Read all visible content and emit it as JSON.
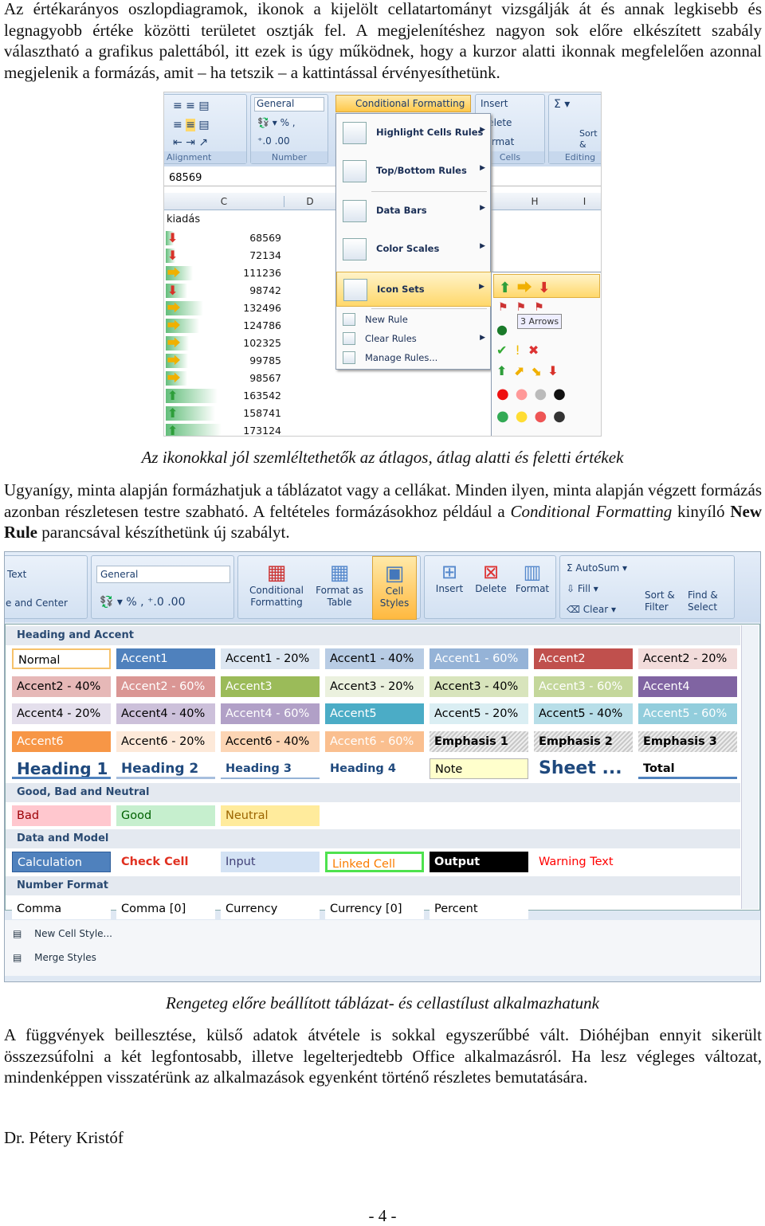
{
  "para1": "Az értékarányos oszlopdiagramok, ikonok a kijelölt cellatartományt vizsgálják át és annak legkisebb és legnagyobb értéke közötti területet osztják fel. A megjelenítéshez nagyon sok előre elkészített szabály választható a grafikus palettából, itt ezek is úgy működnek, hogy a kurzor alatti ikonnak megfelelően azonnal megjelenik a formázás, amit – ha tetszik – a kattintással érvényesíthetünk.",
  "shot1": {
    "ribbon": {
      "number_format": "General",
      "conditional_formatting": "Conditional Formatting",
      "insert": "Insert",
      "delete": "Delete",
      "format": "Format",
      "sort_filter": "Sort & Filter",
      "group_alignment": "Alignment",
      "group_number": "Number",
      "group_cells": "Cells",
      "group_editing": "Editing"
    },
    "formula_value": "68569",
    "columns": [
      "C",
      "D",
      "H",
      "I"
    ],
    "header_cell": "kiadás",
    "rows": [
      {
        "value": 68569,
        "icon": "arrow-down"
      },
      {
        "value": 72134,
        "icon": "arrow-down"
      },
      {
        "value": 111236,
        "icon": "arrow-right"
      },
      {
        "value": 98742,
        "icon": "arrow-down"
      },
      {
        "value": 132496,
        "icon": "arrow-right"
      },
      {
        "value": 124786,
        "icon": "arrow-right"
      },
      {
        "value": 102325,
        "icon": "arrow-right"
      },
      {
        "value": 99785,
        "icon": "arrow-right"
      },
      {
        "value": 98567,
        "icon": "arrow-right"
      },
      {
        "value": 163542,
        "icon": "arrow-up"
      },
      {
        "value": 158741,
        "icon": "arrow-up"
      },
      {
        "value": 173124,
        "icon": "arrow-up"
      }
    ],
    "menu": [
      "Highlight Cells Rules",
      "Top/Bottom Rules",
      "Data Bars",
      "Color Scales",
      "Icon Sets",
      "New Rule",
      "Clear Rules",
      "Manage Rules..."
    ],
    "tooltip": "3 Arrows",
    "colors": {
      "up": "#2e9e3a",
      "right": "#f0b000",
      "down": "#d8322a",
      "databar": "#63be7b",
      "highlight": "#ffd86b"
    }
  },
  "caption1": "Az ikonokkal jól szemléltethetők az átlagos, átlag alatti és feletti értékek",
  "para2": {
    "a": "Ugyanígy, minta alapján formázhatjuk a táblázatot vagy a cellákat. Minden ilyen, minta alapján végzett formázás azonban részletesen testre szabható. A feltételes formázásokhoz például a ",
    "b": "Conditional Formatting",
    "c": " kinyíló ",
    "d": "New Rule",
    "e": " parancsával készíthetünk új szabályt."
  },
  "shot2": {
    "ribbon": {
      "text": "Text",
      "merge": "e and Center",
      "number_format": "General",
      "conditional": "Conditional Formatting",
      "format_table": "Format as Table",
      "cell_styles": "Cell Styles",
      "insert": "Insert",
      "delete": "Delete",
      "format": "Format",
      "autosum": "AutoSum",
      "fill": "Fill",
      "clear": "Clear",
      "sort": "Sort & Filter",
      "find": "Find & Select"
    },
    "sections": [
      {
        "title": "Heading and Accent",
        "rows": [
          [
            {
              "n": "Normal",
              "bg": "#ffffff",
              "fg": "#000000",
              "b": "2px solid #f6c26b"
            },
            {
              "n": "Accent1",
              "bg": "#4f81bd",
              "fg": "#ffffff"
            },
            {
              "n": "Accent1 - 20%",
              "bg": "#dce6f1",
              "fg": "#000"
            },
            {
              "n": "Accent1 - 40%",
              "bg": "#b8cce4",
              "fg": "#000"
            },
            {
              "n": "Accent1 - 60%",
              "bg": "#95b3d7",
              "fg": "#fff"
            },
            {
              "n": "Accent2",
              "bg": "#c0504d",
              "fg": "#fff"
            },
            {
              "n": "Accent2 - 20%",
              "bg": "#f2dcdb",
              "fg": "#000"
            }
          ],
          [
            {
              "n": "Accent2 - 40%",
              "bg": "#e6b8b7",
              "fg": "#000"
            },
            {
              "n": "Accent2 - 60%",
              "bg": "#da9694",
              "fg": "#fff"
            },
            {
              "n": "Accent3",
              "bg": "#9bbb59",
              "fg": "#fff"
            },
            {
              "n": "Accent3 - 20%",
              "bg": "#ebf1de",
              "fg": "#000"
            },
            {
              "n": "Accent3 - 40%",
              "bg": "#d8e4bc",
              "fg": "#000"
            },
            {
              "n": "Accent3 - 60%",
              "bg": "#c4d79b",
              "fg": "#fff"
            },
            {
              "n": "Accent4",
              "bg": "#8064a2",
              "fg": "#fff"
            }
          ],
          [
            {
              "n": "Accent4 - 20%",
              "bg": "#e4dfec",
              "fg": "#000"
            },
            {
              "n": "Accent4 - 40%",
              "bg": "#ccc0da",
              "fg": "#000"
            },
            {
              "n": "Accent4 - 60%",
              "bg": "#b1a0c7",
              "fg": "#fff"
            },
            {
              "n": "Accent5",
              "bg": "#4bacc6",
              "fg": "#fff"
            },
            {
              "n": "Accent5 - 20%",
              "bg": "#daeef3",
              "fg": "#000"
            },
            {
              "n": "Accent5 - 40%",
              "bg": "#b7dee8",
              "fg": "#000"
            },
            {
              "n": "Accent5 - 60%",
              "bg": "#92cddc",
              "fg": "#fff"
            }
          ],
          [
            {
              "n": "Accent6",
              "bg": "#f79646",
              "fg": "#fff"
            },
            {
              "n": "Accent6 - 20%",
              "bg": "#fde9d9",
              "fg": "#000"
            },
            {
              "n": "Accent6 - 40%",
              "bg": "#fcd5b4",
              "fg": "#000"
            },
            {
              "n": "Accent6 - 60%",
              "bg": "#fabf8f",
              "fg": "#fff"
            },
            {
              "n": "Emphasis 1",
              "bg": "hatch",
              "fg": "#000",
              "w": "bold"
            },
            {
              "n": "Emphasis 2",
              "bg": "hatch",
              "fg": "#000",
              "w": "bold"
            },
            {
              "n": "Emphasis 3",
              "bg": "hatch",
              "fg": "#000",
              "w": "bold"
            }
          ],
          [
            {
              "n": "Heading 1",
              "bg": "#fff",
              "fg": "#1f497d",
              "w": "bold",
              "s": "20px",
              "b": "0 0 3px #4f81bd"
            },
            {
              "n": "Heading 2",
              "bg": "#fff",
              "fg": "#1f497d",
              "w": "bold",
              "s": "17px",
              "b": "0 0 3px #a7bfde"
            },
            {
              "n": "Heading 3",
              "bg": "#fff",
              "fg": "#1f497d",
              "w": "bold",
              "s": "14.5px",
              "b": "0 0 2px #95b3d7"
            },
            {
              "n": "Heading 4",
              "bg": "#fff",
              "fg": "#1f497d",
              "w": "bold",
              "s": "14.5px"
            },
            {
              "n": "Note",
              "bg": "#ffffcc",
              "fg": "#000",
              "b": "1px solid #b2b2b2"
            },
            {
              "n": "Sheet ...",
              "bg": "#fff",
              "fg": "#1f497d",
              "w": "bold",
              "s": "22px"
            },
            {
              "n": "Total",
              "bg": "#fff",
              "fg": "#000",
              "w": "bold",
              "b": "0 0 3px #4f81bd"
            }
          ]
        ]
      },
      {
        "title": "Good, Bad and Neutral",
        "rows": [
          [
            {
              "n": "Bad",
              "bg": "#ffc7ce",
              "fg": "#9c0006"
            },
            {
              "n": "Good",
              "bg": "#c6efce",
              "fg": "#006100"
            },
            {
              "n": "Neutral",
              "bg": "#ffeb9c",
              "fg": "#9c6500"
            }
          ]
        ]
      },
      {
        "title": "Data and Model",
        "rows": [
          [
            {
              "n": "Calculation",
              "bg": "#4f81bd",
              "fg": "#fff",
              "b": "1px solid #2d5d9a"
            },
            {
              "n": "Check Cell",
              "bg": "#fff",
              "fg": "#e03020",
              "w": "bold"
            },
            {
              "n": "Input",
              "bg": "#d3e2f4",
              "fg": "#3f3f76"
            },
            {
              "n": "Linked Cell",
              "bg": "#fff",
              "fg": "#fa7d00",
              "b": "3px solid #4ee24e"
            },
            {
              "n": "Output",
              "bg": "#000",
              "fg": "#fff",
              "w": "bold"
            },
            {
              "n": "Warning Text",
              "bg": "#fff",
              "fg": "#ff0000"
            }
          ]
        ]
      },
      {
        "title": "Number Format",
        "rows": [
          [
            {
              "n": "Comma",
              "bg": "#fff",
              "fg": "#000"
            },
            {
              "n": "Comma [0]",
              "bg": "#fff",
              "fg": "#000"
            },
            {
              "n": "Currency",
              "bg": "#fff",
              "fg": "#000"
            },
            {
              "n": "Currency [0]",
              "bg": "#fff",
              "fg": "#000"
            },
            {
              "n": "Percent",
              "bg": "#fff",
              "fg": "#000"
            }
          ]
        ]
      }
    ],
    "footer": [
      "New Cell Style...",
      "Merge Styles"
    ]
  },
  "caption2": "Rengeteg előre beállított táblázat- és cellastílust alkalmazhatunk",
  "para3": "A függvények beillesztése, külső adatok átvétele is sokkal egyszerűbbé vált. Dióhéjban ennyit sikerült összezsúfolni a két legfontosabb, illetve legelterjedtebb Office alkalmazásról. Ha lesz végleges változat, mindenképpen visszatérünk az alkalmazások egyenként történő részletes bemutatására.",
  "author": "Dr. Pétery Kristóf",
  "page_number": "- 4 -"
}
